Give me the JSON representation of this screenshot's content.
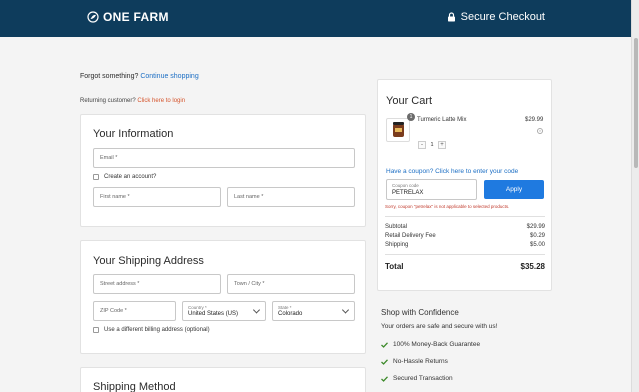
{
  "header": {
    "brand": "ONE FARM",
    "secure_label": "Secure Checkout"
  },
  "top": {
    "forgot_text": "Forgot something?",
    "continue_link": "Continue shopping",
    "returning_text": "Returning customer?",
    "login_link": "Click here to login"
  },
  "info": {
    "title": "Your Information",
    "email_placeholder": "Email *",
    "create_account": "Create an account?",
    "first_name_placeholder": "First name *",
    "last_name_placeholder": "Last name *"
  },
  "shipping": {
    "title": "Your Shipping Address",
    "street_placeholder": "Street address *",
    "city_placeholder": "Town / City *",
    "zip_placeholder": "ZIP Code *",
    "country_label": "Country *",
    "country_value": "United States (US)",
    "state_label": "State *",
    "state_value": "Colorado",
    "different_billing": "Use a different billing address (optional)"
  },
  "shipping_method": {
    "title": "Shipping Method"
  },
  "cart": {
    "title": "Your Cart",
    "item": {
      "name": "Turmeric Latte Mix",
      "price": "$29.99",
      "qty_badge": "1",
      "qty": "1",
      "minus": "-",
      "plus": "+"
    },
    "coupon_prompt": "Have a coupon? Click here to enter your code",
    "coupon_label": "Coupon code",
    "coupon_value": "PETRELAX",
    "apply_label": "Apply",
    "coupon_error": "Sorry, coupon \"petrelax\" is not applicable to selected products.",
    "summary": [
      {
        "label": "Subtotal",
        "value": "$29.99"
      },
      {
        "label": "Retail Delivery Fee",
        "value": "$0.29"
      },
      {
        "label": "Shipping",
        "value": "$5.00"
      }
    ],
    "total_label": "Total",
    "total_value": "$35.28"
  },
  "confidence": {
    "title": "Shop with Confidence",
    "subtitle": "Your orders are safe and secure with us!",
    "items": [
      "100% Money-Back Guarantee",
      "No-Hassle Returns",
      "Secured Transaction"
    ]
  },
  "colors": {
    "header": "#0e3c5c",
    "accent": "#1f7ae0",
    "check": "#3c8a2a",
    "error": "#c0392b",
    "login_link": "#d5542c"
  }
}
